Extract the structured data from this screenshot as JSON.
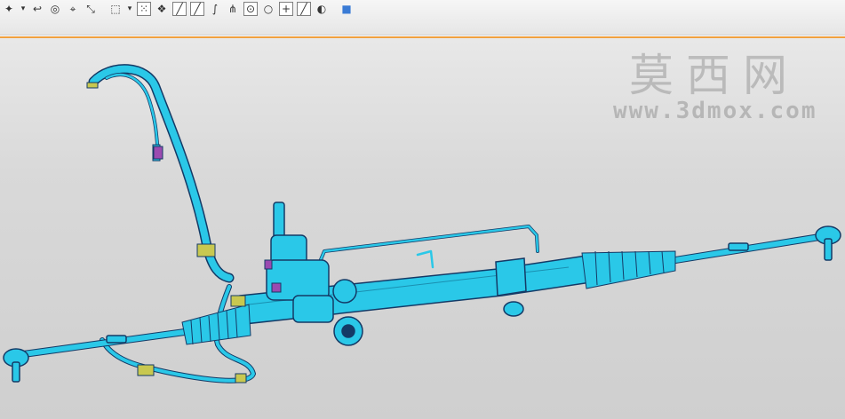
{
  "toolbar": {
    "tools": [
      "star-icon",
      "undo-icon",
      "orient-icon",
      "snap-icon",
      "measure-icon",
      "select-box-icon",
      "point-grid-icon",
      "style-icon",
      "line-icon",
      "curve-icon",
      "tangent-icon",
      "branch-icon",
      "circle-icon",
      "arc-icon",
      "cross-icon",
      "diagonal-icon",
      "palette-icon",
      "cube-icon"
    ]
  },
  "watermark": {
    "chinese": "莫西网",
    "url": "www.3dmox.com"
  },
  "colors": {
    "accent": "#f0a040",
    "part": "#2ac8e8",
    "edge": "#143a66",
    "bracket": "#c8c850",
    "clip": "#9b4ab0"
  }
}
